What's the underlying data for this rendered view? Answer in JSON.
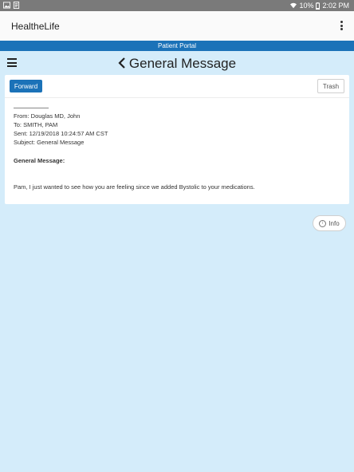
{
  "status_bar": {
    "battery": "10%",
    "time": "2:02 PM"
  },
  "app": {
    "title": "HealtheLife"
  },
  "portal_bar": {
    "label": "Patient Portal"
  },
  "nav": {
    "title": "General Message"
  },
  "toolbar": {
    "forward_label": "Forward",
    "trash_label": "Trash"
  },
  "message": {
    "from": "From: Douglas MD, John",
    "to": "To: SMITH, PAM",
    "sent": "Sent: 12/19/2018 10:24:57 AM CST",
    "subject": "Subject: General Message",
    "label": "General Message:",
    "body": "Pam, I just wanted to see how you are feeling since we added Bystolic to your medications."
  },
  "info_button": {
    "label": "Info"
  },
  "colors": {
    "accent": "#1b72b8",
    "background": "#d4ecfa",
    "status_bar": "#7a7a7a"
  }
}
